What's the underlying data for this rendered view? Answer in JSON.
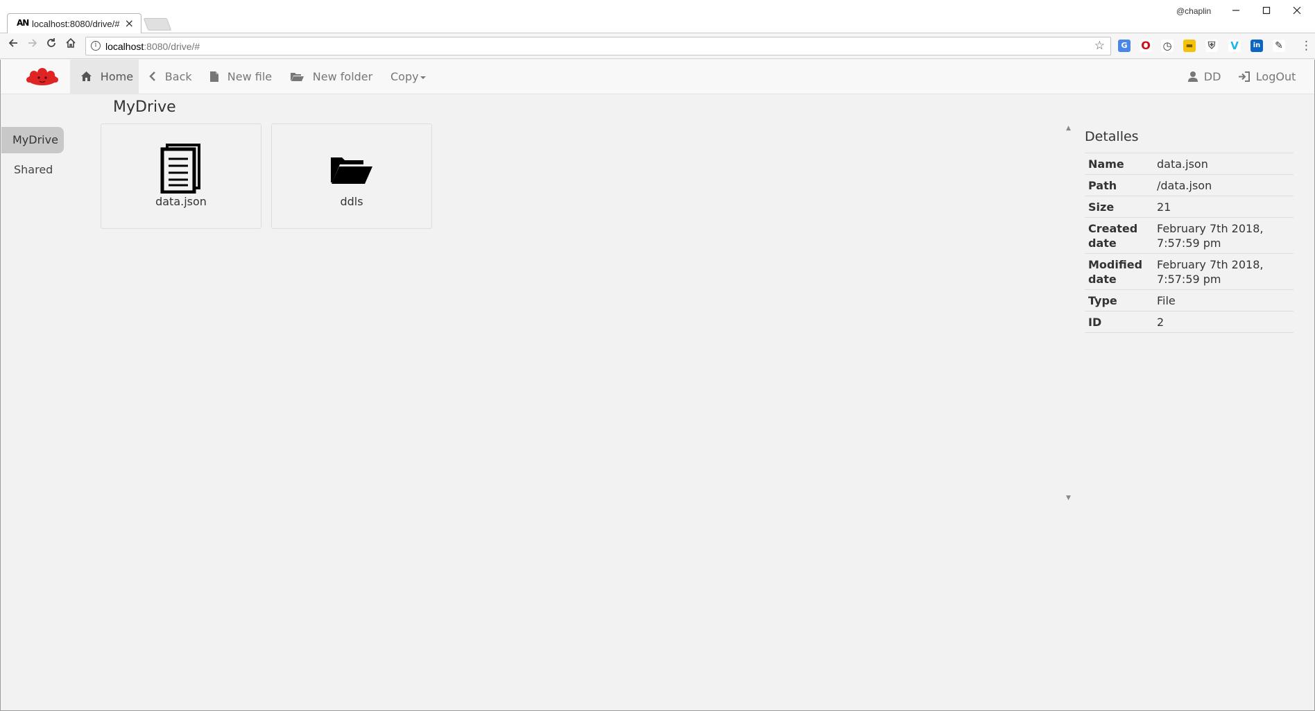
{
  "browser": {
    "tab_favicon": "AN",
    "tab_title": "localhost:8080/drive/#",
    "tab_close": "×",
    "profile_name": "@chaplin",
    "url_host": "localhost",
    "url_path": ":8080/drive/#",
    "icons": [
      "back-arrow-icon",
      "forward-arrow-icon",
      "reload-icon",
      "home-icon",
      "info-icon",
      "star-icon",
      "menu-icon"
    ]
  },
  "navbar": {
    "home_label": "Home",
    "back_label": "Back",
    "new_file_label": "New file",
    "new_folder_label": "New folder",
    "copy_label": "Copy",
    "user_label": "DD",
    "logout_label": "LogOut"
  },
  "sidebar": {
    "items": [
      {
        "label": "MyDrive",
        "active": true
      },
      {
        "label": "Shared",
        "active": false
      }
    ]
  },
  "main": {
    "title": "MyDrive",
    "files": [
      {
        "name": "data.json",
        "kind": "file",
        "icon": "document-icon"
      },
      {
        "name": "ddls",
        "kind": "folder",
        "icon": "folder-open-icon"
      }
    ]
  },
  "details": {
    "title": "Detalles",
    "rows": [
      {
        "key": "Name",
        "value": "data.json"
      },
      {
        "key": "Path",
        "value": "/data.json"
      },
      {
        "key": "Size",
        "value": "21"
      },
      {
        "key": "Created date",
        "value": "February 7th 2018, 7:57:59 pm"
      },
      {
        "key": "Modified date",
        "value": "February 7th 2018, 7:57:59 pm"
      },
      {
        "key": "Type",
        "value": "File"
      },
      {
        "key": "ID",
        "value": "2"
      }
    ]
  },
  "colors": {
    "background": "#f2f2f2",
    "navbar_bg": "#f8f8f8",
    "active_pill": "#c8c8c8",
    "logo_red": "#e02424"
  }
}
